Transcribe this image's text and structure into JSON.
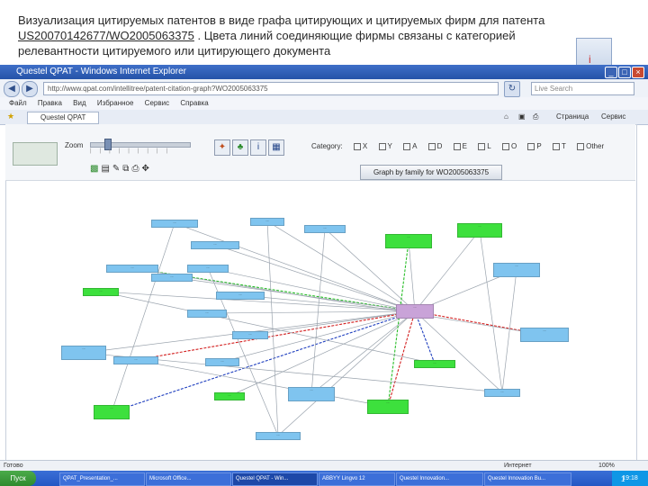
{
  "slide": {
    "caption_line1": "Визуализация цитируемых патентов в виде графа  цитирующих и цитируемых фирм  для патента",
    "caption_patent": "US20070142677/WO2005063375",
    "caption_line2_rest": " .   Цвета линий соединяющие фирмы  связаны с категорией",
    "caption_line3": "релевантности цитируемого или цитирующего  документа"
  },
  "window": {
    "title": "Questel QPAT - Windows Internet Explorer",
    "url": "http://www.qpat.com/intellitree/patent-citation-graph?WO2005063375",
    "search_placeholder": "Live Search",
    "menu": [
      "Файл",
      "Правка",
      "Вид",
      "Избранное",
      "Сервис",
      "Справка"
    ],
    "tab_label": "Questel QPAT",
    "tab_right": [
      "Страница",
      "Сервис"
    ]
  },
  "app": {
    "zoom_label": "Zoom",
    "category_label": "Category:",
    "categories": [
      "X",
      "Y",
      "A",
      "D",
      "E",
      "L",
      "O",
      "P",
      "T",
      "Other"
    ],
    "graph_button": "Graph by family for WO2005063375"
  },
  "graph": {
    "nodes": [
      {
        "id": "n1",
        "label": "...",
        "color": "blue"
      },
      {
        "id": "n2",
        "label": "...",
        "color": "blue"
      },
      {
        "id": "n3",
        "label": "...",
        "color": "blue"
      },
      {
        "id": "n4",
        "label": "...",
        "color": "green"
      },
      {
        "id": "n5",
        "label": "...",
        "color": "blue"
      },
      {
        "id": "n6",
        "label": "...",
        "color": "green"
      },
      {
        "id": "n7",
        "label": "...",
        "color": "blue"
      },
      {
        "id": "n8",
        "label": "...",
        "color": "blue"
      },
      {
        "id": "n9",
        "label": "...",
        "color": "blue"
      },
      {
        "id": "n10",
        "label": "...",
        "color": "blue"
      },
      {
        "id": "n11",
        "label": "...",
        "color": "green"
      },
      {
        "id": "n12",
        "label": "...",
        "color": "blue"
      },
      {
        "id": "n13",
        "label": "...",
        "color": "blue"
      },
      {
        "id": "n14",
        "label": "...",
        "color": "purple"
      },
      {
        "id": "n15",
        "label": "...",
        "color": "blue"
      },
      {
        "id": "n16",
        "label": "...",
        "color": "blue"
      },
      {
        "id": "n17",
        "label": "...",
        "color": "blue"
      },
      {
        "id": "n18",
        "label": "...",
        "color": "blue"
      },
      {
        "id": "n19",
        "label": "...",
        "color": "blue"
      },
      {
        "id": "n20",
        "label": "...",
        "color": "green"
      },
      {
        "id": "n21",
        "label": "...",
        "color": "green"
      },
      {
        "id": "n22",
        "label": "...",
        "color": "blue"
      },
      {
        "id": "n23",
        "label": "...",
        "color": "green"
      },
      {
        "id": "n24",
        "label": "...",
        "color": "green"
      },
      {
        "id": "n25",
        "label": "...",
        "color": "blue"
      },
      {
        "id": "n26",
        "label": "...",
        "color": "blue"
      }
    ],
    "edge_colors": {
      "default": "#9aa3ad",
      "red": "#d32020",
      "blue": "#1f3fbf",
      "green": "#2bbf2b"
    }
  },
  "status": {
    "left": "Готово",
    "right": "Интернет",
    "zoom": "100%"
  },
  "taskbar": {
    "start": "Пуск",
    "tasks": [
      "QPAT_Presentation_...",
      "Microsoft Office...",
      "Questel QPAT - Win...",
      "ABBYY Lingvo 12",
      "Questel Innovation...",
      "Questel Innovation Bu..."
    ],
    "clock": "19:18",
    "page_number": "1"
  }
}
